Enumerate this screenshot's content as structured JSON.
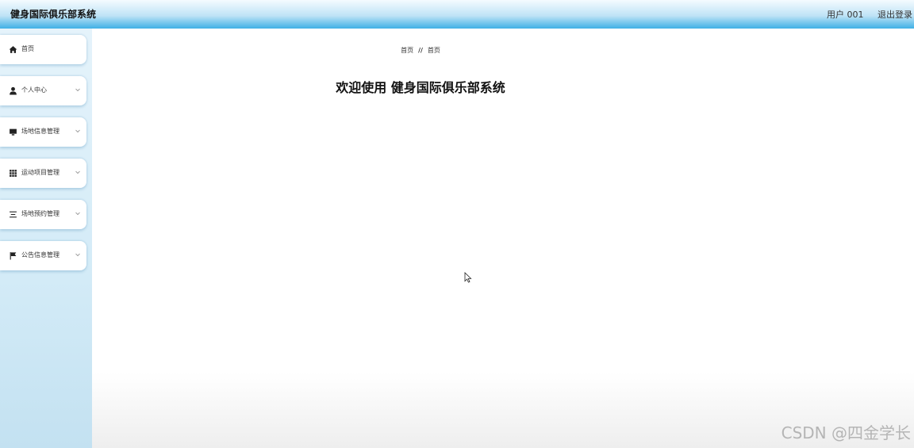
{
  "header": {
    "title": "健身国际俱乐部系统",
    "user": "用户 001",
    "logout": "退出登录"
  },
  "sidebar": {
    "items": [
      {
        "label": "首页",
        "icon": "home-icon"
      },
      {
        "label": "个人中心",
        "icon": "user-icon"
      },
      {
        "label": "场地信息管理",
        "icon": "monitor-icon"
      },
      {
        "label": "运动项目管理",
        "icon": "grid-icon"
      },
      {
        "label": "场地预约管理",
        "icon": "list-icon"
      },
      {
        "label": "公告信息管理",
        "icon": "flag-icon"
      }
    ]
  },
  "main": {
    "breadcrumb": {
      "first": "首页",
      "separator": "//",
      "second": "首页"
    },
    "welcome": "欢迎使用 健身国际俱乐部系统"
  },
  "watermark": "CSDN @四金学长",
  "colors": {
    "header_gradient_bottom": "#3fb0e6",
    "sidebar_bg": "#d3ebf7"
  }
}
